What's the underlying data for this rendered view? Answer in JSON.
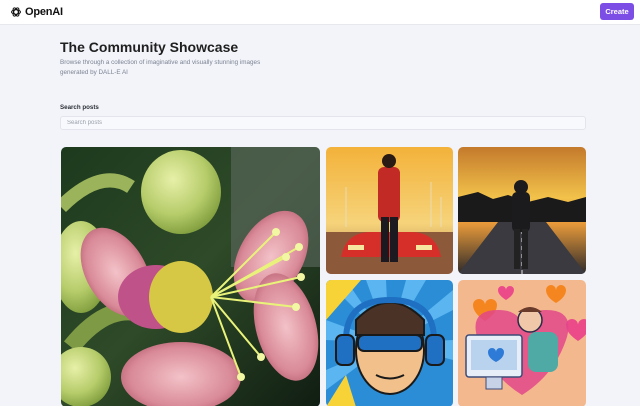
{
  "header": {
    "brand": "OpenAI",
    "create_label": "Create"
  },
  "main": {
    "title": "The Community Showcase",
    "description": "Browse through a collection of imaginative and visually stunning images generated by DALL-E AI",
    "search_label": "Search posts",
    "search_placeholder": "Search posts"
  },
  "colors": {
    "accent": "#7d4ee6",
    "background": "#f2f4f9"
  },
  "icons": {
    "logo": "openai-logo-icon"
  }
}
